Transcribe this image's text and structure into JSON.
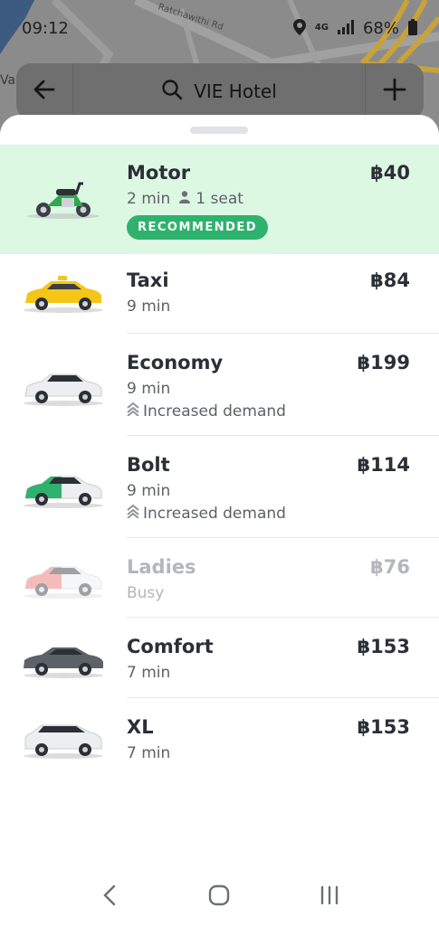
{
  "status_bar": {
    "time": "09:12",
    "network": "4G",
    "battery": "68%",
    "icons": [
      "location-icon",
      "signal-icon",
      "battery-icon"
    ]
  },
  "map": {
    "street_label": "Ratchawithi Rd",
    "edge_label": "Va"
  },
  "search": {
    "destination": "VIE Hotel",
    "icons": [
      "back-arrow-icon",
      "search-icon",
      "add-icon"
    ]
  },
  "rides": [
    {
      "name": "Motor",
      "price": "฿40",
      "eta": "2 min",
      "seats": "1 seat",
      "badge": "RECOMMENDED",
      "vehicle": "motorbike",
      "selected": true
    },
    {
      "name": "Taxi",
      "price": "฿84",
      "eta": "9 min",
      "vehicle": "taxi"
    },
    {
      "name": "Economy",
      "price": "฿199",
      "eta": "9 min",
      "note": "Increased demand",
      "vehicle": "economy-car"
    },
    {
      "name": "Bolt",
      "price": "฿114",
      "eta": "9 min",
      "note": "Increased demand",
      "vehicle": "bolt-car"
    },
    {
      "name": "Ladies",
      "price": "฿76",
      "eta": "Busy",
      "vehicle": "ladies-car",
      "disabled": true
    },
    {
      "name": "Comfort",
      "price": "฿153",
      "eta": "7 min",
      "vehicle": "comfort-car"
    },
    {
      "name": "XL",
      "price": "฿153",
      "eta": "7 min",
      "vehicle": "xl-car"
    }
  ],
  "colors": {
    "accent": "#2fb26d",
    "selected_bg": "#dcf8e3",
    "text": "#2b2f36",
    "muted": "#5d6168",
    "disabled": "#b3b6bb"
  },
  "nav": {
    "icons": [
      "back-nav-icon",
      "home-nav-icon",
      "recents-nav-icon"
    ]
  }
}
